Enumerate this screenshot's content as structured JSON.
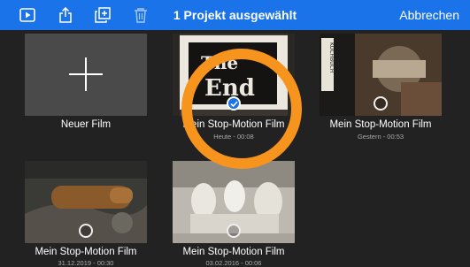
{
  "topbar": {
    "title": "1 Projekt ausgewählt",
    "cancel_label": "Abbrechen",
    "icons": [
      "play-icon",
      "share-icon",
      "duplicate-icon",
      "trash-icon"
    ]
  },
  "new_film": {
    "label": "Neuer Film"
  },
  "projects": [
    {
      "title": "Mein Stop-Motion Film",
      "date": "Heute - 00:08",
      "selected": true,
      "thumb_text": "The End"
    },
    {
      "title": "Mein Stop-Motion Film",
      "date": "Gestern - 00:53",
      "selected": false
    },
    {
      "title": "Mein Stop-Motion Film",
      "date": "31.12.2019 - 00:30",
      "selected": false
    },
    {
      "title": "Mein Stop-Motion Film",
      "date": "03.02.2016 - 00:06",
      "selected": false
    }
  ],
  "colors": {
    "accent": "#1a73e8",
    "highlight": "#f7941d",
    "background": "#222222"
  }
}
